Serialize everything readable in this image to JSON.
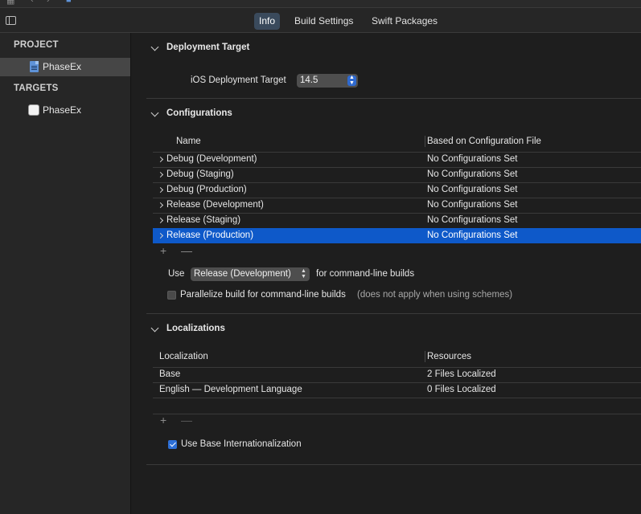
{
  "toolbar_top": {
    "icons": [
      "grid-icon",
      "back-arrow-icon",
      "forward-arrow-icon",
      "project-file-icon"
    ]
  },
  "tabs": [
    {
      "label": "Info",
      "active": true
    },
    {
      "label": "Build Settings",
      "active": false
    },
    {
      "label": "Swift Packages",
      "active": false
    }
  ],
  "sidebar": {
    "project_header": "PROJECT",
    "project_item": "PhaseEx",
    "targets_header": "TARGETS",
    "target_item": "PhaseEx"
  },
  "deployment": {
    "title": "Deployment Target",
    "label": "iOS Deployment Target",
    "value": "14.5"
  },
  "configurations": {
    "title": "Configurations",
    "col_name": "Name",
    "col_based_on": "Based on Configuration File",
    "rows": [
      {
        "name": "Debug (Development)",
        "file": "No Configurations Set"
      },
      {
        "name": "Debug (Staging)",
        "file": "No Configurations Set"
      },
      {
        "name": "Debug (Production)",
        "file": "No Configurations Set"
      },
      {
        "name": "Release (Development)",
        "file": "No Configurations Set"
      },
      {
        "name": "Release (Staging)",
        "file": "No Configurations Set"
      },
      {
        "name": "Release (Production)",
        "file": "No Configurations Set"
      }
    ],
    "selected_row": 5,
    "add_symbol": "+",
    "remove_symbol": "—",
    "use_label": "Use",
    "use_value": "Release (Development)",
    "use_suffix": "for command-line builds",
    "parallelize_label": "Parallelize build for command-line builds",
    "parallelize_note": "(does not apply when using schemes)",
    "parallelize_checked": false
  },
  "localizations": {
    "title": "Localizations",
    "col_localization": "Localization",
    "col_resources": "Resources",
    "rows": [
      {
        "name": "Base",
        "resources": "2 Files Localized"
      },
      {
        "name": "English — Development Language",
        "resources": "0 Files Localized"
      }
    ],
    "add_symbol": "+",
    "remove_symbol": "—",
    "base_intl_label": "Use Base Internationalization",
    "base_intl_checked": true
  },
  "colors": {
    "selection": "#0e59c9",
    "accent": "#2d6fd6",
    "tab_active_bg": "#3a4a5c"
  }
}
